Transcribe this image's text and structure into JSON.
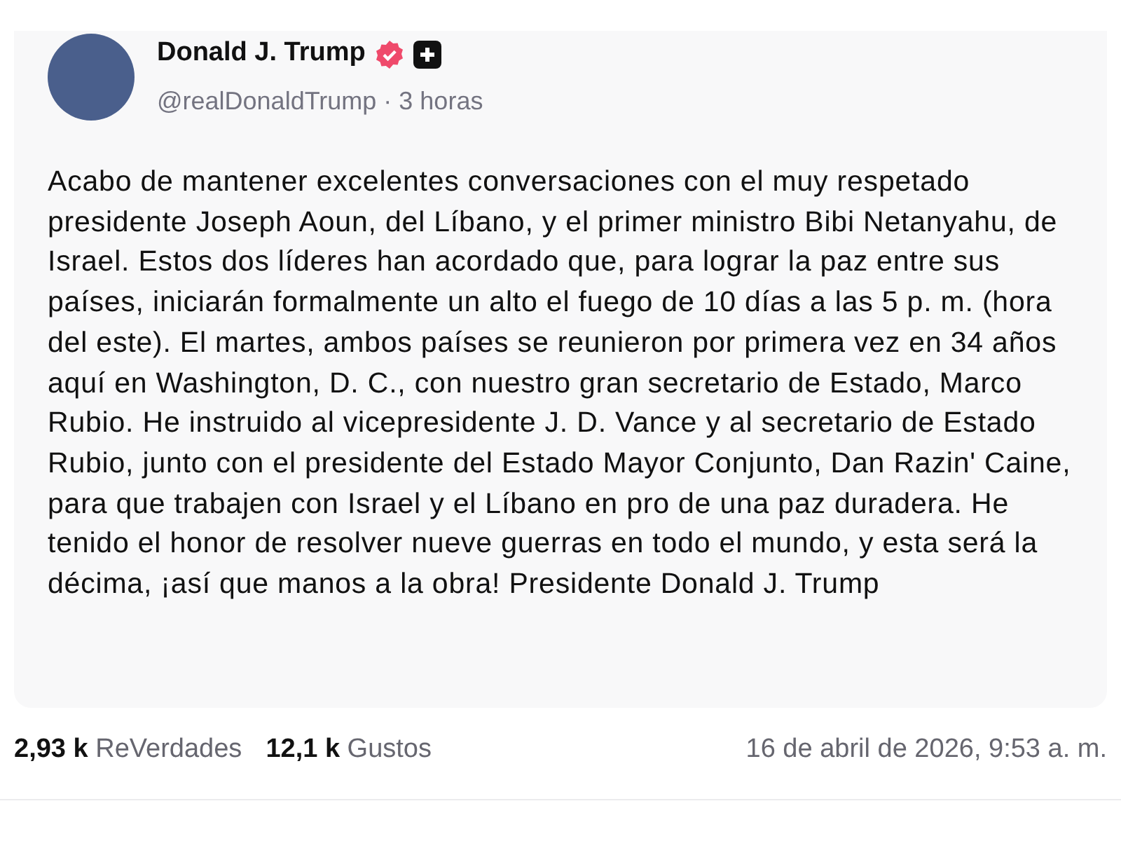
{
  "post": {
    "author": {
      "name": "Donald J. Trump",
      "verified": true,
      "handle": "@realDonaldTrump",
      "separator": "·",
      "time": "3 horas"
    },
    "text": "Acabo de mantener excelentes conversaciones con el muy respetado presidente Joseph Aoun, del Líbano, y el primer ministro Bibi Netanyahu, de Israel. Estos dos líderes han acordado que, para lograr la paz entre sus países, iniciarán formalmente un alto el fuego de 10 días a las 5 p. m. (hora del este). El martes, ambos países se reunieron por primera vez en 34 años aquí en Washington, D. C., con nuestro gran secretario de Estado, Marco Rubio. He instruido al vicepresidente J. D. Vance y al secretario de Estado Rubio, junto con el presidente del Estado Mayor Conjunto, Dan Razin' Caine, para que trabajen con Israel y el Líbano en pro de una paz duradera. He tenido el honor de resolver nueve guerras en todo el mundo, y esta será la décima, ¡así que manos a la obra! Presidente Donald J. Trump"
  },
  "stats": [
    {
      "count": "2,93 k",
      "label": "ReVerdades"
    },
    {
      "count": "12,1 k",
      "label": "Gustos"
    }
  ],
  "timestamp": "16 de abril de 2026, 9:53 a. m."
}
